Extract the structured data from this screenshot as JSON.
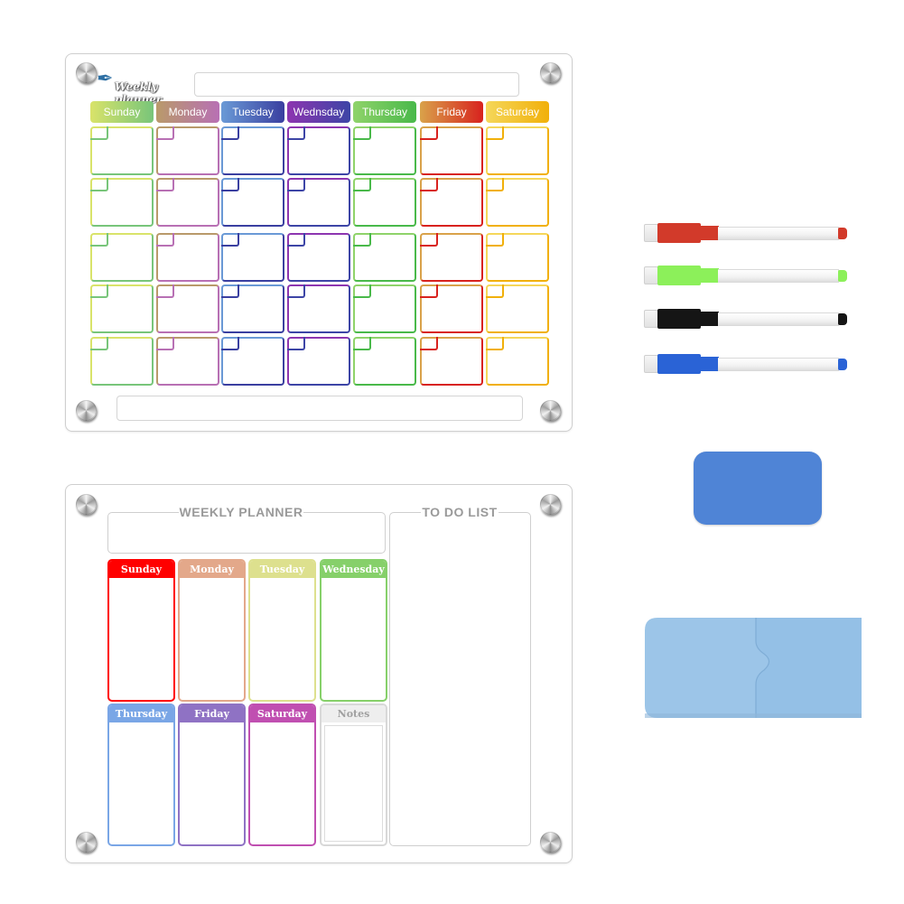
{
  "board_monthly": {
    "logo_text": "Weekly planner",
    "logo_icon": "hummingbird-icon",
    "days": [
      {
        "label": "Sunday",
        "from": "#d9e36a",
        "to": "#78c57a"
      },
      {
        "label": "Monday",
        "from": "#b99a6a",
        "to": "#b870b4"
      },
      {
        "label": "Tuesday",
        "from": "#6a9ad6",
        "to": "#3a3fa0"
      },
      {
        "label": "Wednsday",
        "from": "#8d35b0",
        "to": "#3d45a6"
      },
      {
        "label": "Thursday",
        "from": "#8fd36a",
        "to": "#49b94a"
      },
      {
        "label": "Friday",
        "from": "#d9a24a",
        "to": "#d8221e"
      },
      {
        "label": "Saturday",
        "from": "#f5d75a",
        "to": "#f1b00a"
      }
    ],
    "rows": 5
  },
  "board_weekly": {
    "planner_title": "WEEKLY PLANNER",
    "todo_title": "TO DO LIST",
    "days": [
      {
        "label": "Sunday",
        "color": "#ff0000"
      },
      {
        "label": "Monday",
        "color": "#e3a88a"
      },
      {
        "label": "Tuesday",
        "color": "#dde08e"
      },
      {
        "label": "Wednesday",
        "color": "#86d06a"
      },
      {
        "label": "Thursday",
        "color": "#7aa6e6"
      },
      {
        "label": "Friday",
        "color": "#8f72c4"
      },
      {
        "label": "Saturday",
        "color": "#c04fb1"
      }
    ],
    "notes_label": "Notes"
  },
  "accessories": {
    "markers": [
      {
        "name": "red-marker",
        "color": "#d23a2a"
      },
      {
        "name": "green-marker",
        "color": "#8cf05a"
      },
      {
        "name": "black-marker",
        "color": "#151515"
      },
      {
        "name": "blue-marker",
        "color": "#2a63d6"
      }
    ],
    "eraser_color": "#4f84d6",
    "holder_color": "#9cc5e8"
  }
}
